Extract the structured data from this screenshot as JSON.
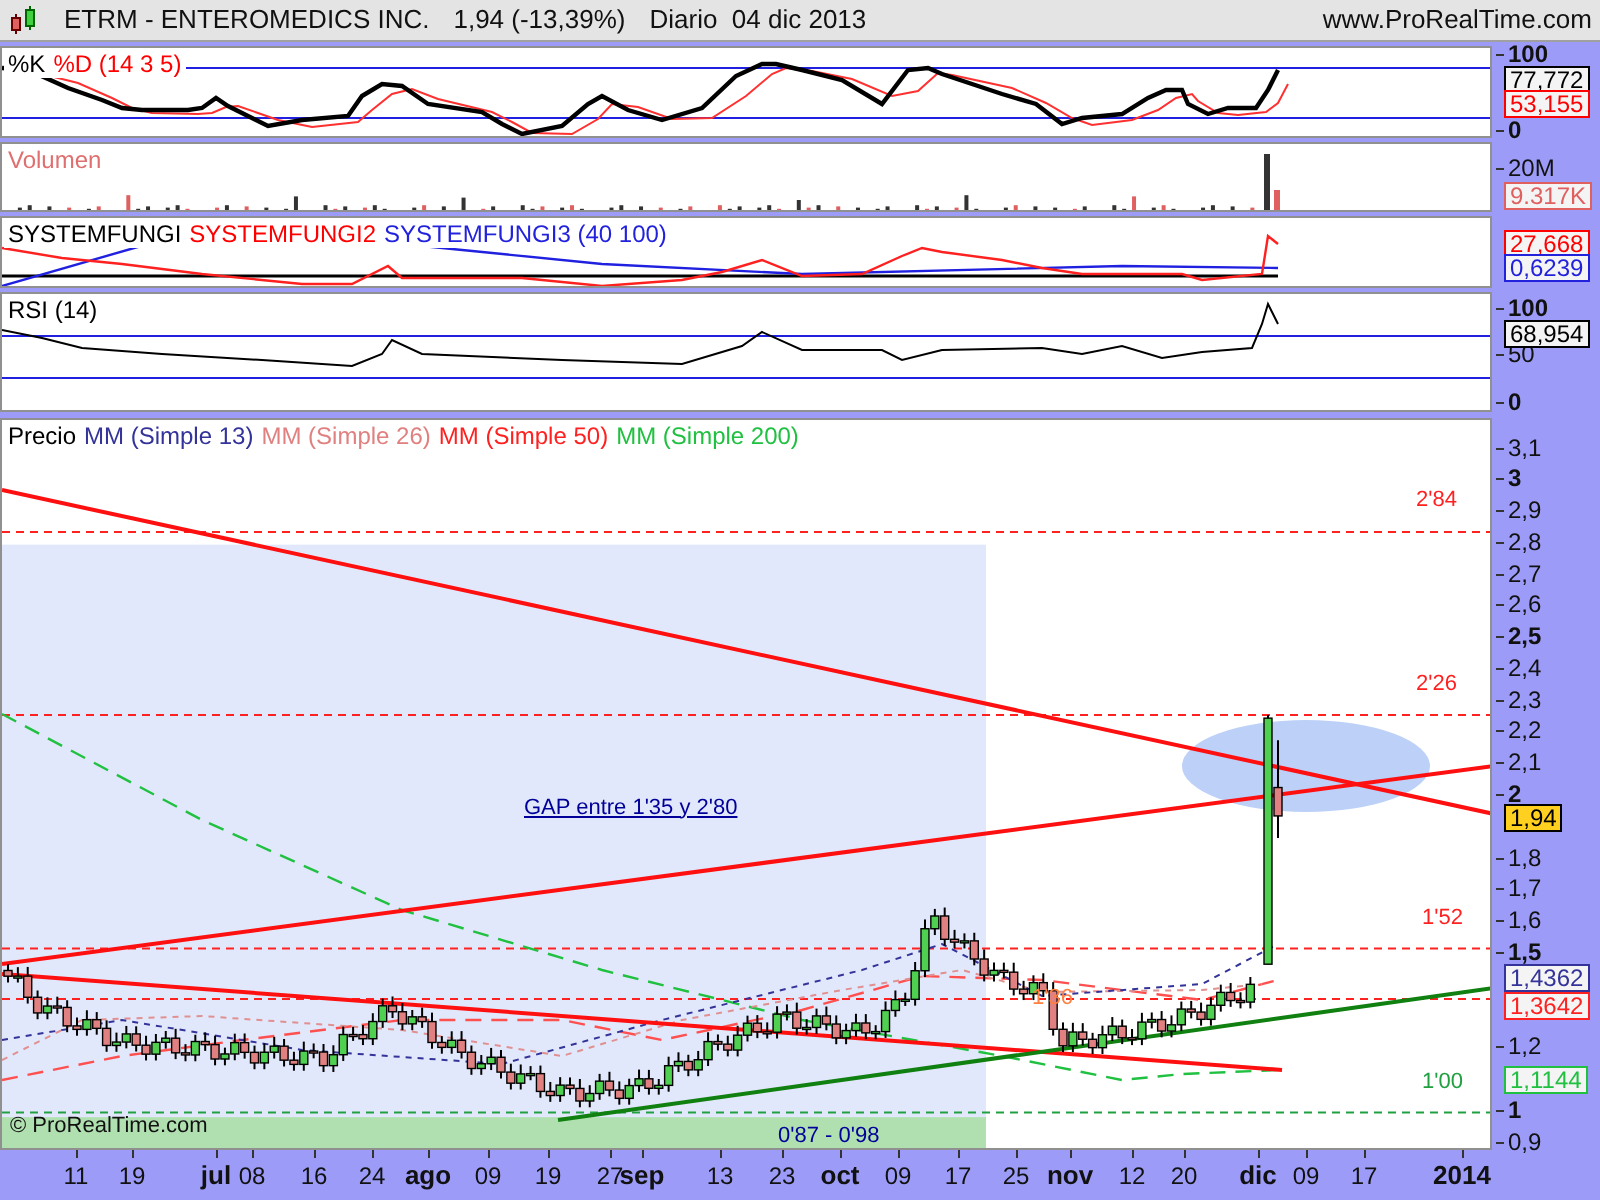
{
  "header": {
    "symbol": "ETRM - ENTEROMEDICS INC.",
    "quote": "1,94 (-13,39%)",
    "period": "Diario  04 dic 2013",
    "site": "www.ProRealTime.com"
  },
  "panels": [
    {
      "kind": "stochastic",
      "title": [
        {
          "text": "%K",
          "color": "#000000"
        },
        {
          "text": "%D (14 3 5)",
          "color": "#ff0000"
        }
      ],
      "ticks": [
        {
          "label": "100",
          "major": true
        },
        {
          "label": "0",
          "major": true
        }
      ],
      "badges": [
        {
          "text": "77,772",
          "color": "#000000"
        },
        {
          "text": "53,155",
          "color": "#ff0000"
        }
      ]
    },
    {
      "kind": "volume",
      "title": [
        {
          "text": "Volumen",
          "color": "#e07070"
        }
      ],
      "ticks": [
        {
          "label": "20M",
          "major": false
        }
      ],
      "badges": [
        {
          "text": "9.317K",
          "color": "#e06060"
        }
      ]
    },
    {
      "kind": "oscillator",
      "title": [
        {
          "text": "SYSTEMFUNGI",
          "color": "#000000"
        },
        {
          "text": "SYSTEMFUNGI2",
          "color": "#ff0000"
        },
        {
          "text": "SYSTEMFUNGI3 (40 100)",
          "color": "#2222dd"
        }
      ],
      "badges": [
        {
          "text": "27,668",
          "color": "#ff0000"
        },
        {
          "text": "0,6239",
          "color": "#2222dd"
        }
      ]
    },
    {
      "kind": "rsi",
      "title": [
        {
          "text": "RSI (14)",
          "color": "#000000"
        }
      ],
      "ticks": [
        {
          "label": "100",
          "major": true
        },
        {
          "label": "50",
          "major": false
        },
        {
          "label": "0",
          "major": true
        }
      ],
      "badges": [
        {
          "text": "68,954",
          "color": "#000000"
        }
      ]
    },
    {
      "kind": "price",
      "title": [
        {
          "text": "Precio",
          "color": "#000000"
        },
        {
          "text": "MM (Simple 13)",
          "color": "#333399"
        },
        {
          "text": "MM (Simple 26)",
          "color": "#e08080"
        },
        {
          "text": "MM (Simple 50)",
          "color": "#ff2020"
        },
        {
          "text": "MM (Simple 200)",
          "color": "#20c040"
        }
      ],
      "ticks": [
        {
          "label": "3,1",
          "major": false
        },
        {
          "label": "3",
          "major": true
        },
        {
          "label": "2,9",
          "major": false
        },
        {
          "label": "2,8",
          "major": false
        },
        {
          "label": "2,7",
          "major": false
        },
        {
          "label": "2,6",
          "major": false
        },
        {
          "label": "2,5",
          "major": true
        },
        {
          "label": "2,4",
          "major": false
        },
        {
          "label": "2,3",
          "major": false
        },
        {
          "label": "2,2",
          "major": false
        },
        {
          "label": "2,1",
          "major": false
        },
        {
          "label": "2",
          "major": true
        },
        {
          "label": "1,8",
          "major": false
        },
        {
          "label": "1,7",
          "major": false
        },
        {
          "label": "1,6",
          "major": false
        },
        {
          "label": "1,5",
          "major": true
        },
        {
          "label": "1,2",
          "major": false
        },
        {
          "label": "1",
          "major": true
        },
        {
          "label": "0,9",
          "major": false
        }
      ],
      "badges": [
        {
          "text": "1,94",
          "color": "#000000"
        },
        {
          "text": "1,4362",
          "color": "#333399"
        },
        {
          "text": "1,3642",
          "color": "#ff2020"
        },
        {
          "text": "1,1144",
          "color": "#20c040"
        }
      ]
    }
  ],
  "annotations": [
    {
      "kind": "level",
      "text": "2'84",
      "color": "#ff2020"
    },
    {
      "kind": "level",
      "text": "2'26",
      "color": "#ff2020"
    },
    {
      "kind": "level",
      "text": "1'52",
      "color": "#ff2020"
    },
    {
      "kind": "level",
      "text": "1'36",
      "color": "#ff8040"
    },
    {
      "kind": "level",
      "text": "1'00",
      "color": "#20a040"
    },
    {
      "kind": "gap",
      "text": "GAP entre 1'35 y 2'80",
      "color": "#000099"
    },
    {
      "kind": "zone",
      "text": "0'87 - 0'98",
      "color": "#000099"
    }
  ],
  "copyright": "© ProRealTime.com",
  "x_axis": [
    {
      "label": "11",
      "month": false
    },
    {
      "label": "19",
      "month": false
    },
    {
      "label": "jul",
      "month": true
    },
    {
      "label": "08",
      "month": false
    },
    {
      "label": "16",
      "month": false
    },
    {
      "label": "24",
      "month": false
    },
    {
      "label": "ago",
      "month": true
    },
    {
      "label": "09",
      "month": false
    },
    {
      "label": "19",
      "month": false
    },
    {
      "label": "27",
      "month": false
    },
    {
      "label": "sep",
      "month": true
    },
    {
      "label": "13",
      "month": false
    },
    {
      "label": "23",
      "month": false
    },
    {
      "label": "oct",
      "month": true
    },
    {
      "label": "09",
      "month": false
    },
    {
      "label": "17",
      "month": false
    },
    {
      "label": "25",
      "month": false
    },
    {
      "label": "nov",
      "month": true
    },
    {
      "label": "12",
      "month": false
    },
    {
      "label": "20",
      "month": false
    },
    {
      "label": "dic",
      "month": true
    },
    {
      "label": "09",
      "month": false
    },
    {
      "label": "17",
      "month": false
    },
    {
      "label": "2014",
      "month": true
    }
  ]
}
